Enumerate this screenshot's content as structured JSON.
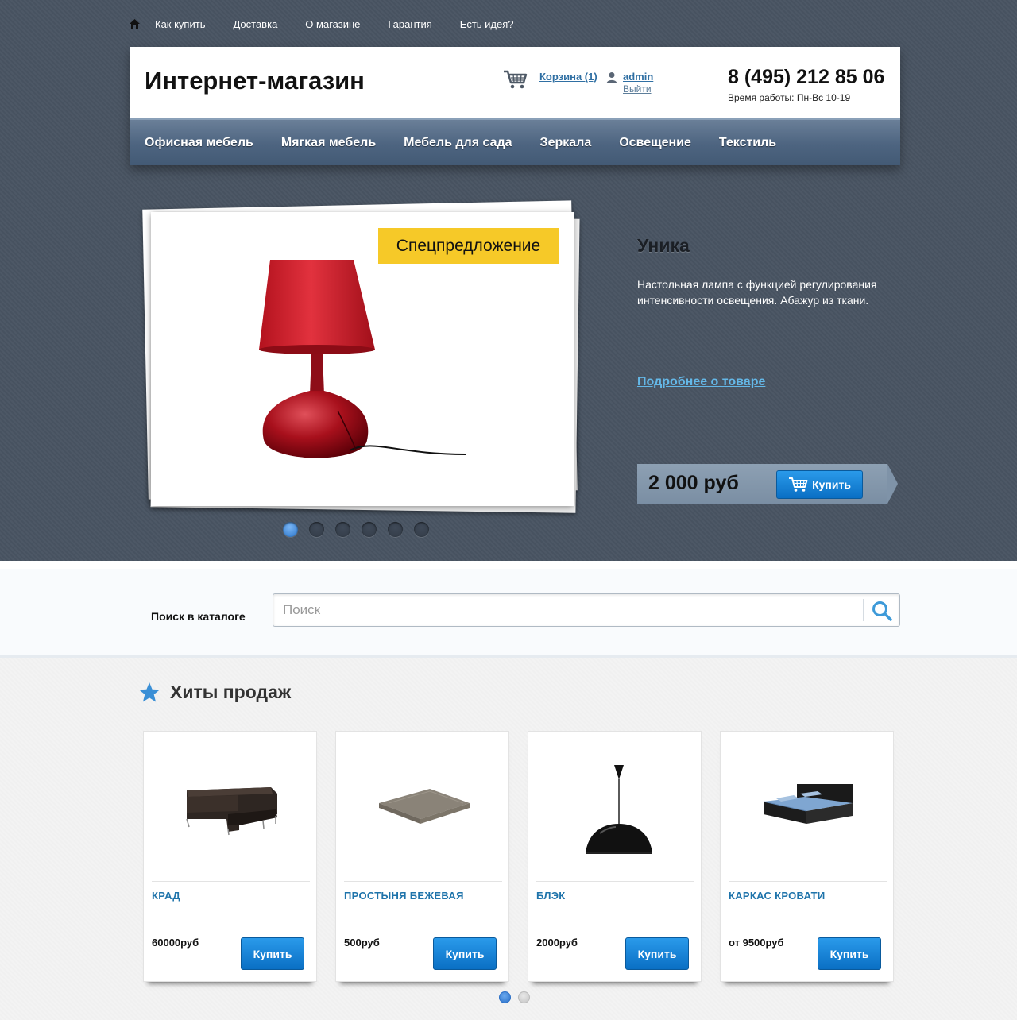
{
  "top_nav": {
    "items": [
      "Как купить",
      "Доставка",
      "О магазине",
      "Гарантия",
      "Есть идея?"
    ]
  },
  "header": {
    "title": "Интернет-магазин",
    "cart_label": "Корзина (1)",
    "user_label": "admin",
    "logout_label": "Выйти",
    "phone": "8 (495) 212 85 06",
    "work_hours": "Время работы: Пн-Вс 10-19"
  },
  "categories": [
    "Офисная мебель",
    "Мягкая мебель",
    "Мебель для сада",
    "Зеркала",
    "Освещение",
    "Текстиль"
  ],
  "promo": {
    "badge": "Спецпредложение",
    "name": "Уника",
    "description": "Настольная лампа с функцией регулирования интенсивности освещения. Абажур из ткани.",
    "details_link": "Подробнее о товаре",
    "price": "2 000 руб",
    "buy_label": "Купить",
    "slides_count": 6,
    "active_slide": 1
  },
  "search": {
    "label": "Поиск в каталоге",
    "placeholder": "Поиск"
  },
  "hits": {
    "title": "Хиты продаж",
    "products": [
      {
        "name": "КРАД",
        "price": "60000руб",
        "buy_label": "Купить"
      },
      {
        "name": "ПРОСТЫНЯ БЕЖЕВАЯ",
        "price": "500руб",
        "buy_label": "Купить"
      },
      {
        "name": "БЛЭК",
        "price": "2000руб",
        "buy_label": "Купить"
      },
      {
        "name": "КАРКАС КРОВАТИ",
        "price": "от 9500руб",
        "buy_label": "Купить"
      }
    ],
    "pages_count": 2,
    "active_page": 1
  },
  "colors": {
    "dark_background": "#495462",
    "accent_blue": "#1a85d8",
    "link_blue": "#2f6fa3",
    "badge_yellow": "#f6c928"
  }
}
